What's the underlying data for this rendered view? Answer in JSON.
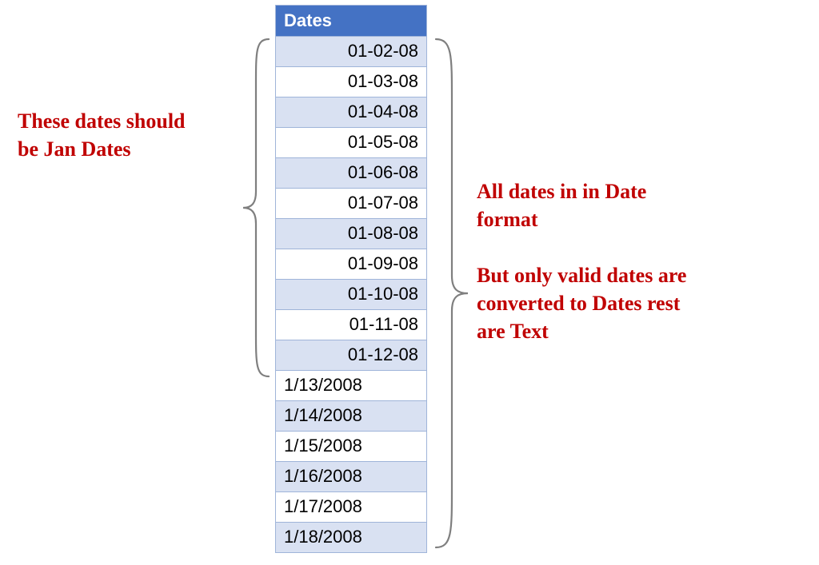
{
  "table": {
    "header": "Dates",
    "rows": [
      {
        "value": "01-02-08",
        "align": "right"
      },
      {
        "value": "01-03-08",
        "align": "right"
      },
      {
        "value": "01-04-08",
        "align": "right"
      },
      {
        "value": "01-05-08",
        "align": "right"
      },
      {
        "value": "01-06-08",
        "align": "right"
      },
      {
        "value": "01-07-08",
        "align": "right"
      },
      {
        "value": "01-08-08",
        "align": "right"
      },
      {
        "value": "01-09-08",
        "align": "right"
      },
      {
        "value": "01-10-08",
        "align": "right"
      },
      {
        "value": "01-11-08",
        "align": "right"
      },
      {
        "value": "01-12-08",
        "align": "right"
      },
      {
        "value": "1/13/2008",
        "align": "left"
      },
      {
        "value": "1/14/2008",
        "align": "left"
      },
      {
        "value": "1/15/2008",
        "align": "left"
      },
      {
        "value": "1/16/2008",
        "align": "left"
      },
      {
        "value": "1/17/2008",
        "align": "left"
      },
      {
        "value": "1/18/2008",
        "align": "left"
      }
    ]
  },
  "annotations": {
    "left": "These dates should\nbe Jan Dates",
    "right": "All dates in in Date\nformat\n\nBut only valid dates are\nconverted to Dates rest\nare Text"
  },
  "colors": {
    "header_bg": "#4472C4",
    "band_a": "#D9E1F2",
    "band_b": "#FFFFFF",
    "annotation": "#C00000",
    "brace": "#7F7F7F"
  }
}
